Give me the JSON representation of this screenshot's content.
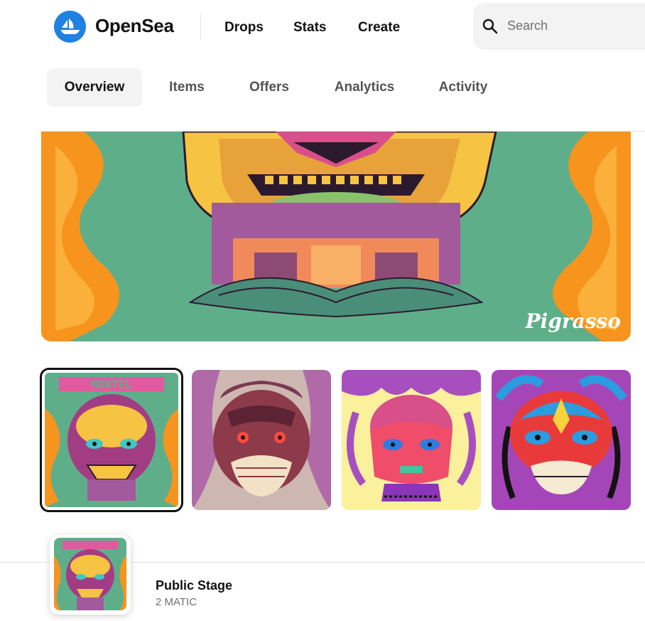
{
  "header": {
    "brand": "OpenSea",
    "nav": [
      "Drops",
      "Stats",
      "Create"
    ],
    "search_placeholder": "Search",
    "logo_icon": "opensea-ship-icon",
    "search_icon": "search-icon"
  },
  "tabs": [
    "Overview",
    "Items",
    "Offers",
    "Analytics",
    "Activity"
  ],
  "active_tab": "Overview",
  "hero": {
    "signature": "Pigrasso"
  },
  "thumbnails": [
    {
      "label": "MONTEL",
      "selected": true
    },
    {
      "label": "",
      "selected": false
    },
    {
      "label": "",
      "selected": false
    },
    {
      "label": "",
      "selected": false
    }
  ],
  "stage": {
    "title": "Public Stage",
    "price": "2 MATIC"
  },
  "colors": {
    "accent": "#2081e2",
    "hero_bg": "#5fae8a"
  }
}
